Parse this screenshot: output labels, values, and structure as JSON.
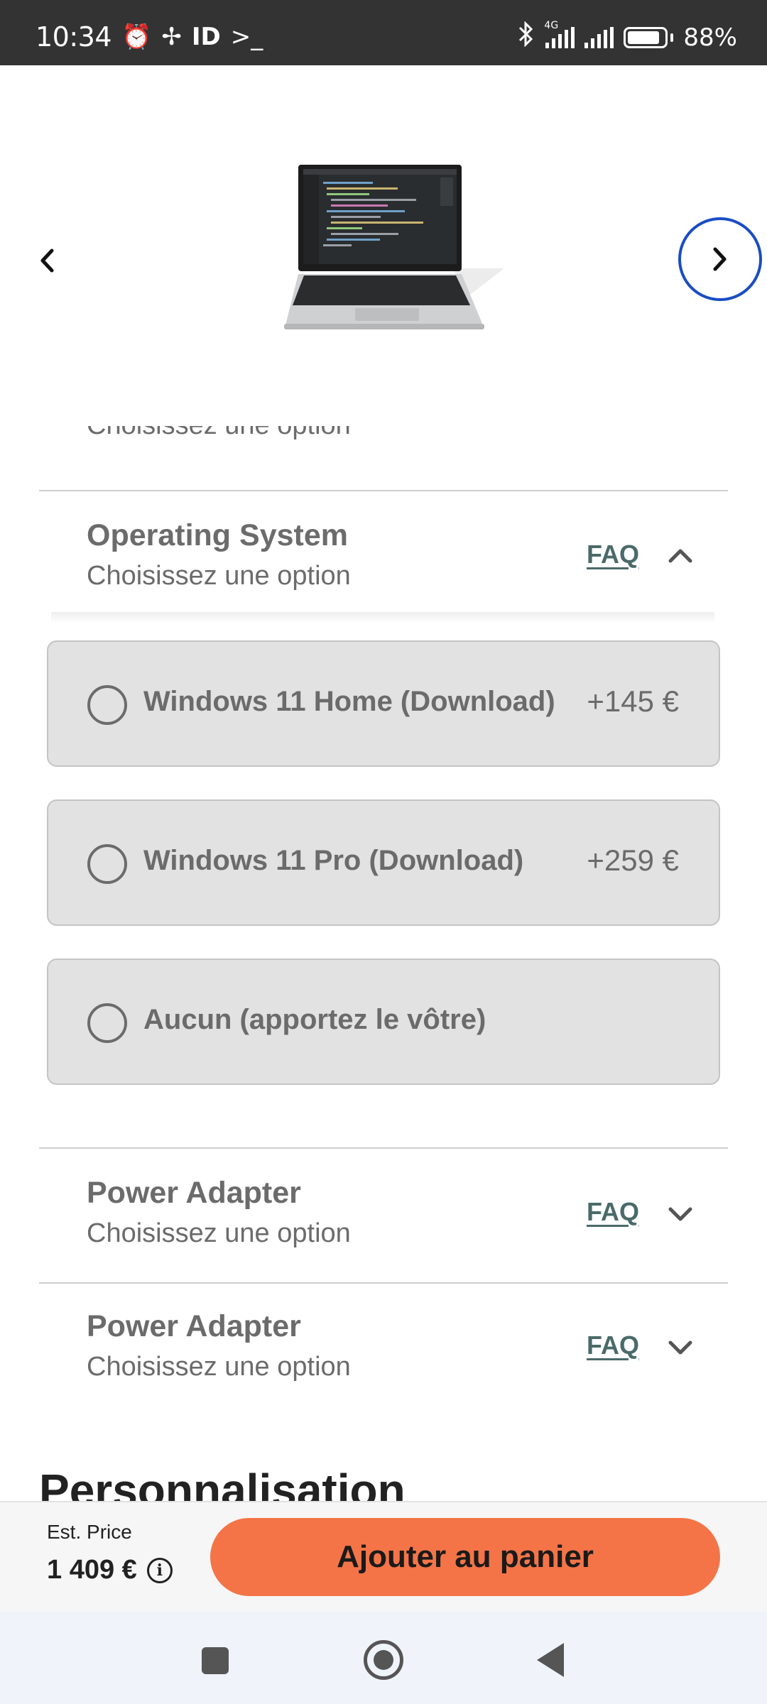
{
  "status_bar": {
    "time": "10:34",
    "id_label": "ID",
    "terminal_glyph": ">_",
    "network_type": "4G",
    "battery_percent": "88%",
    "battery_level": 0.88,
    "icons": [
      "alarm-icon",
      "fan-icon",
      "terminal-icon",
      "bluetooth-icon",
      "signal-icon",
      "signal-icon",
      "battery-icon"
    ]
  },
  "carousel": {
    "prev_icon": "chevron-left-icon",
    "next_icon": "chevron-right-icon",
    "image": "laptop-product-image"
  },
  "previous_section": {
    "subtitle_cut": "Choisissez une option"
  },
  "os_section": {
    "title": "Operating System",
    "subtitle": "Choisissez une option",
    "faq_label": "FAQ",
    "expanded": true,
    "options": [
      {
        "label": "Windows 11 Home (Download)",
        "price": "+145 €"
      },
      {
        "label": "Windows 11 Pro (Download)",
        "price": "+259 €"
      },
      {
        "label": "Aucun (apportez le vôtre)",
        "price": ""
      }
    ]
  },
  "power_sections": [
    {
      "title": "Power Adapter",
      "subtitle": "Choisissez une option",
      "faq_label": "FAQ"
    },
    {
      "title": "Power Adapter",
      "subtitle": "Choisissez une option",
      "faq_label": "FAQ"
    }
  ],
  "personalisation": {
    "title": "Personnalisation"
  },
  "bottom_bar": {
    "est_label": "Est. Price",
    "price": "1 409 €",
    "add_to_cart": "Ajouter au panier"
  },
  "colors": {
    "accent_button": "#f47447",
    "next_ring": "#1a4dc4",
    "faq_link": "#4b6a6a",
    "option_bg": "#e2e2e2"
  }
}
